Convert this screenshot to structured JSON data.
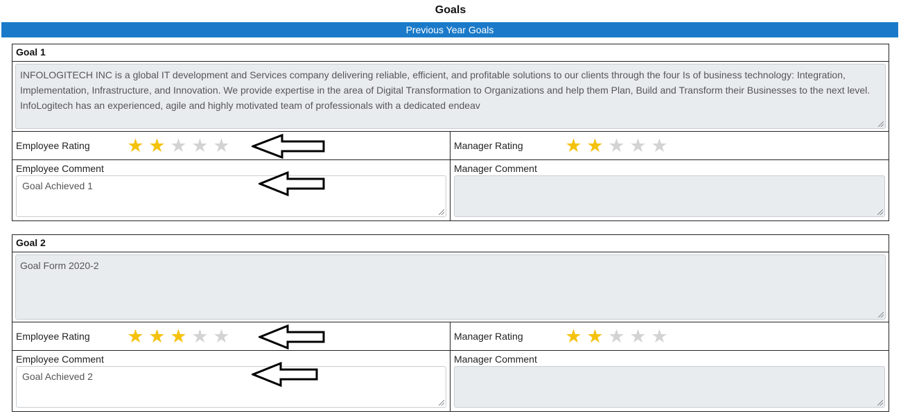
{
  "page": {
    "title": "Goals"
  },
  "section": {
    "title": "Previous Year Goals"
  },
  "labels": {
    "employee_rating": "Employee Rating",
    "manager_rating": "Manager Rating",
    "employee_comment": "Employee Comment",
    "manager_comment": "Manager Comment"
  },
  "goals": [
    {
      "title": "Goal 1",
      "description": "INFOLOGITECH INC is a global IT development and Services company delivering reliable, efficient, and profitable solutions to our clients through the four Is of business technology: Integration, Implementation, Infrastructure, and Innovation. We provide expertise in the area of Digital Transformation to Organizations and help them Plan, Build and Transform their Businesses to the next level. InfoLogitech has an experienced, agile and highly motivated team of professionals with a dedicated endeav",
      "employee_rating": 2,
      "manager_rating": 2,
      "employee_comment": "Goal Achieved 1",
      "manager_comment": ""
    },
    {
      "title": "Goal 2",
      "description": "Goal Form 2020-2",
      "employee_rating": 3,
      "manager_rating": 2,
      "employee_comment": "Goal Achieved 2",
      "manager_comment": ""
    }
  ],
  "rating_max": 5,
  "colors": {
    "section_bar": "#1a7ac9",
    "star_filled": "#f4c20d",
    "star_empty": "#d3d3d3",
    "disabled_field": "#e9ecef"
  },
  "icons": {
    "star": "star-icon",
    "annotation_arrow": "left-arrow-icon",
    "resize": "resize-grip-icon"
  }
}
